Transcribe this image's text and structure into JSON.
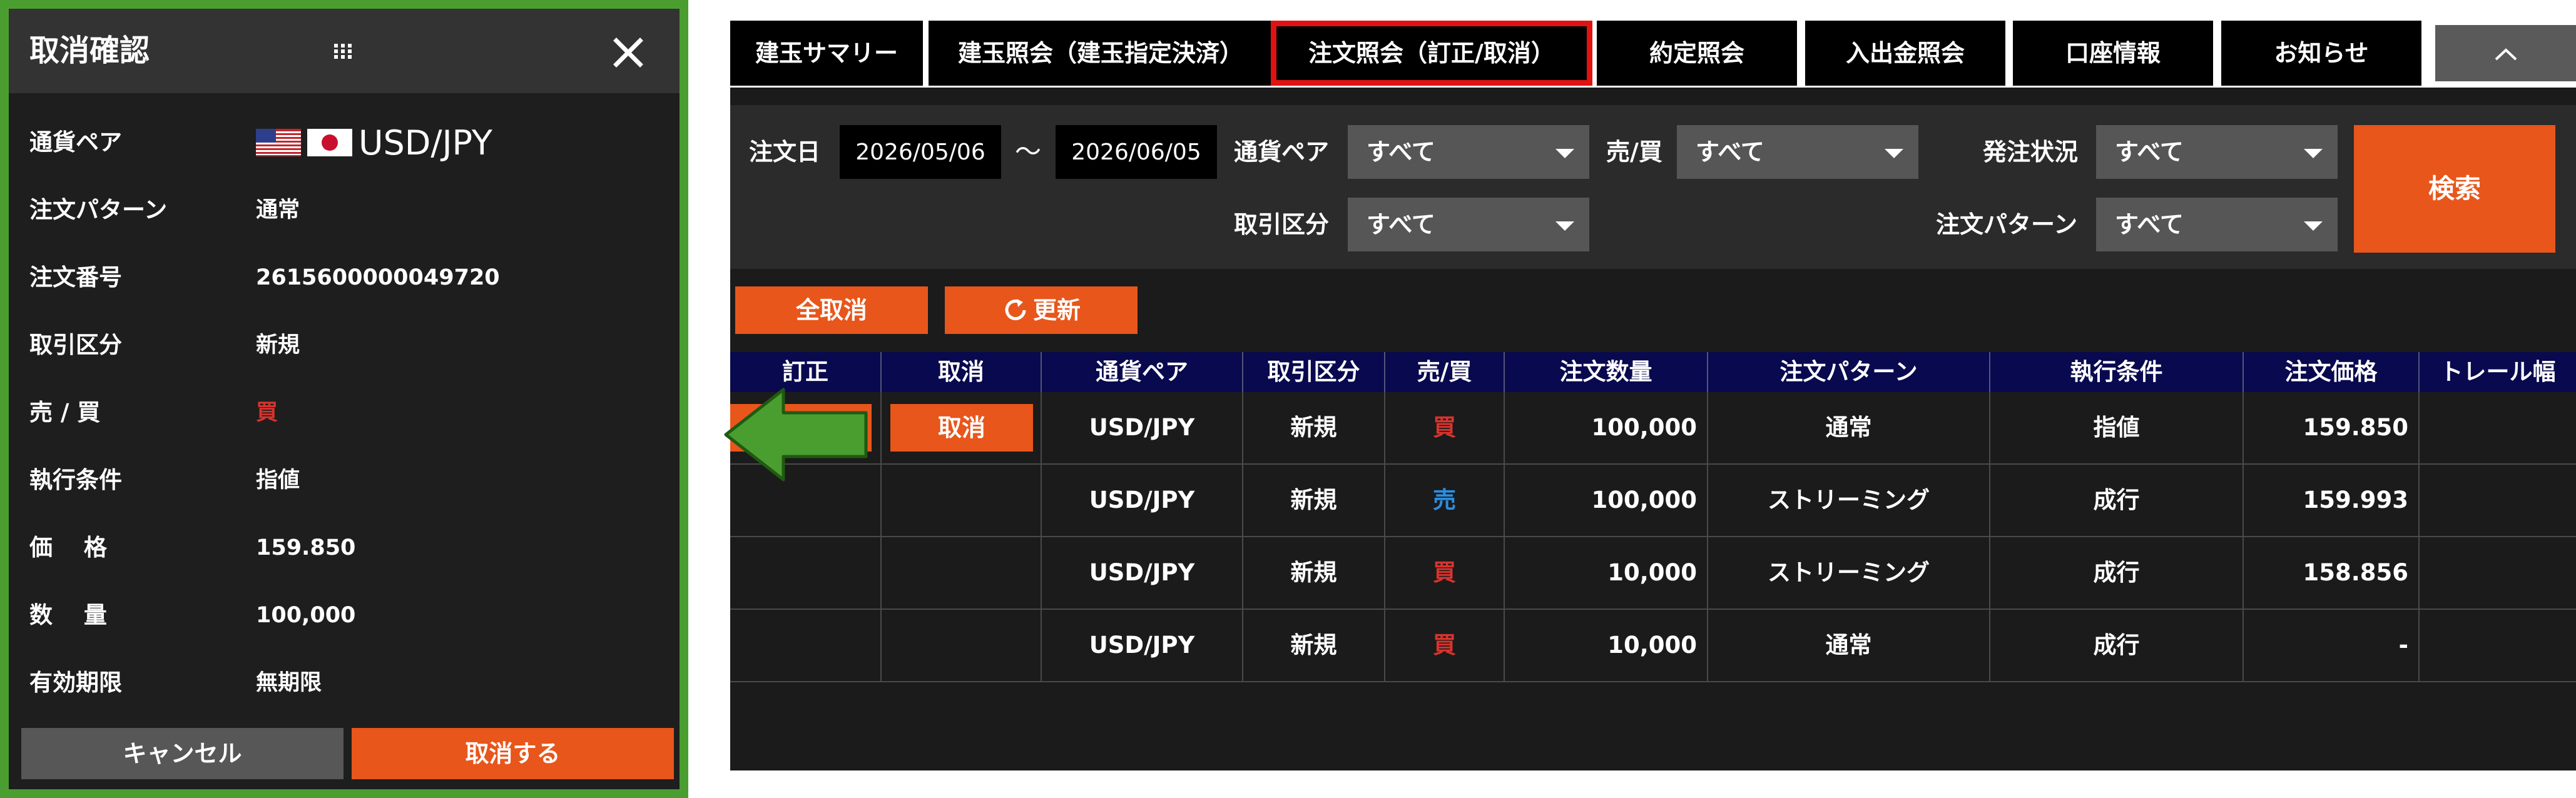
{
  "dialog": {
    "title": "取消確認",
    "rows": [
      {
        "label": "通貨ペア",
        "value": "USD/JPY"
      },
      {
        "label": "注文パターン",
        "value": "通常"
      },
      {
        "label": "注文番号",
        "value": "2615600000049720"
      },
      {
        "label": "取引区分",
        "value": "新規"
      },
      {
        "label": "売 / 買",
        "value": "買"
      },
      {
        "label": "執行条件",
        "value": "指値"
      },
      {
        "label": "価　 格",
        "value": "159.850"
      },
      {
        "label": "数　 量",
        "value": "100,000"
      },
      {
        "label": "有効期限",
        "value": "無期限"
      }
    ],
    "cancel_label": "キャンセル",
    "confirm_label": "取消する"
  },
  "tabs": [
    {
      "label": "建玉サマリー"
    },
    {
      "label": "建玉照会（建玉指定決済）"
    },
    {
      "label": "注文照会（訂正/取消）"
    },
    {
      "label": "約定照会"
    },
    {
      "label": "入出金照会"
    },
    {
      "label": "口座情報"
    },
    {
      "label": "お知らせ"
    },
    {
      "label": "^"
    }
  ],
  "filters": {
    "order_date_label": "注文日",
    "date_from": "2026/05/06",
    "tilde": "～",
    "date_to": "2026/06/05",
    "pair_label": "通貨ペア",
    "pair_value": "すべて",
    "side_label": "売/買",
    "side_value": "すべて",
    "status_label": "発注状況",
    "status_value": "すべて",
    "trade_type_label": "取引区分",
    "trade_type_value": "すべて",
    "pattern_label": "注文パターン",
    "pattern_value": "すべて",
    "search_label": "検索"
  },
  "actions": {
    "cancel_all_label": "全取消",
    "refresh_label": "更新"
  },
  "table": {
    "columns": [
      "訂正",
      "取消",
      "通貨ペア",
      "取引区分",
      "売/買",
      "注文数量",
      "注文パターン",
      "執行条件",
      "注文価格",
      "トレール幅"
    ],
    "cancel_button_label": "取消",
    "rows": [
      {
        "pair": "USD/JPY",
        "trade_type": "新規",
        "side": "買",
        "qty": "100,000",
        "pattern": "通常",
        "condition": "指値",
        "price": "159.850",
        "trail": ""
      },
      {
        "pair": "USD/JPY",
        "trade_type": "新規",
        "side": "売",
        "qty": "100,000",
        "pattern": "ストリーミング",
        "condition": "成行",
        "price": "159.993",
        "trail": ""
      },
      {
        "pair": "USD/JPY",
        "trade_type": "新規",
        "side": "買",
        "qty": "10,000",
        "pattern": "ストリーミング",
        "condition": "成行",
        "price": "158.856",
        "trail": ""
      },
      {
        "pair": "USD/JPY",
        "trade_type": "新規",
        "side": "買",
        "qty": "10,000",
        "pattern": "通常",
        "condition": "成行",
        "price": "-",
        "trail": ""
      }
    ]
  },
  "colors": {
    "accent": "#e8561b",
    "dialog_border": "#4a9e2f",
    "active_tab_border": "#e01212",
    "buy": "#d8342e",
    "sell": "#2e8ee0",
    "table_header": "#09094f"
  }
}
